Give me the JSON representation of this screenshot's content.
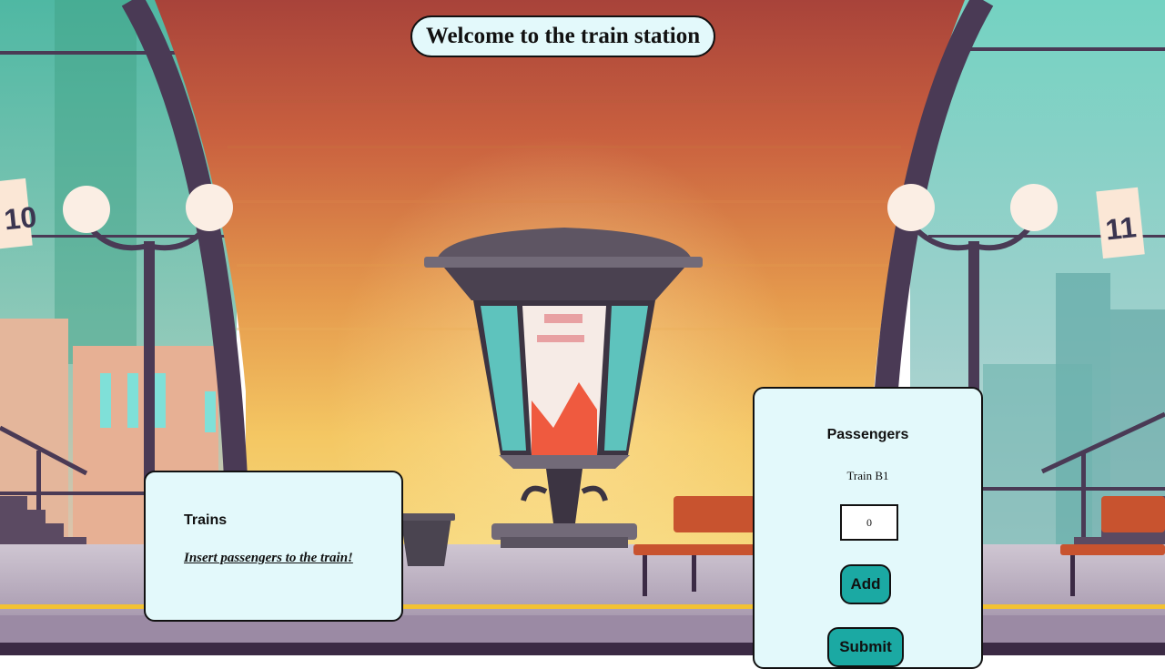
{
  "page": {
    "title": "Welcome to the train station"
  },
  "scene": {
    "sign_left": "10",
    "sign_right": "11"
  },
  "trains_panel": {
    "heading": "Trains",
    "message": "Insert passengers to the train!"
  },
  "passengers_panel": {
    "heading": "Passengers",
    "train_name": "Train B1",
    "count_value": "0",
    "add_label": "Add",
    "submit_label": "Submit"
  },
  "colors": {
    "panel_bg": "#e3f9fb",
    "button_teal": "#1ba9a3",
    "border": "#111111"
  }
}
